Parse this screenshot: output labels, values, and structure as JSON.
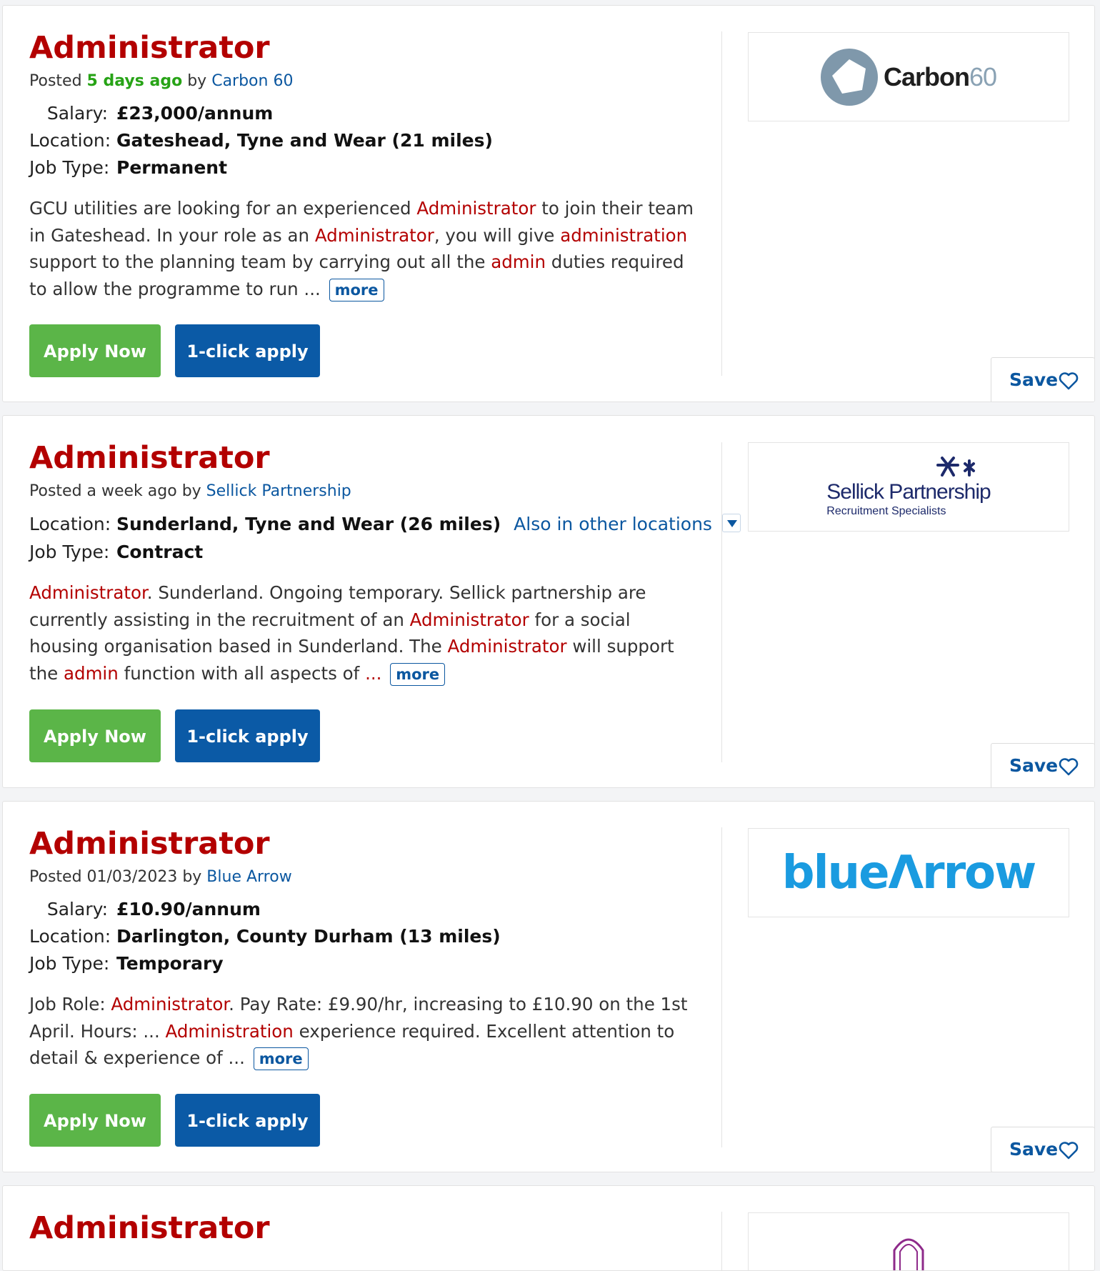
{
  "jobs": [
    {
      "title": "Administrator",
      "posted_prefix": "Posted ",
      "posted_when": "5 days ago",
      "posted_by_text": " by ",
      "company": "Carbon 60",
      "salary_label": "Salary:",
      "salary": "£23,000/annum",
      "location_label": "Location:",
      "location": "Gateshead, Tyne and Wear (21 miles)",
      "jobtype_label": "Job Type:",
      "jobtype": "Permanent",
      "desc": [
        {
          "t": "GCU utilities are looking for an experienced ",
          "h": false
        },
        {
          "t": "Administrator",
          "h": true
        },
        {
          "t": " to join their team in Gateshead. In your role as an ",
          "h": false
        },
        {
          "t": "Administrator",
          "h": true
        },
        {
          "t": ", you will give ",
          "h": false
        },
        {
          "t": "administration",
          "h": true
        },
        {
          "t": " support to the planning team by carrying out all the ",
          "h": false
        },
        {
          "t": "admin",
          "h": true
        },
        {
          "t": " duties required to allow the programme to run ...",
          "h": false
        }
      ],
      "more_label": "more",
      "apply_label": "Apply Now",
      "oneclick_label": "1-click apply",
      "save_label": "Save",
      "logo_text_main": "Carbon",
      "logo_text_num": "60"
    },
    {
      "title": "Administrator",
      "posted_text": "Posted a week ago by ",
      "company": "Sellick Partnership",
      "location_label": "Location:",
      "location": "Sunderland, Tyne and Wear (26 miles)",
      "other_locations": "Also in other locations",
      "jobtype_label": "Job Type:",
      "jobtype": "Contract",
      "desc": [
        {
          "t": "Administrator",
          "h": true
        },
        {
          "t": ". Sunderland. Ongoing temporary. Sellick partnership are currently assisting in the recruitment of an ",
          "h": false
        },
        {
          "t": "Administrator",
          "h": true
        },
        {
          "t": " for a social housing organisation based in Sunderland. The ",
          "h": false
        },
        {
          "t": "Administrator",
          "h": true
        },
        {
          "t": " will support the ",
          "h": false
        },
        {
          "t": "admin",
          "h": true
        },
        {
          "t": " function with all aspects of ",
          "h": false
        },
        {
          "t": "...",
          "h": true
        }
      ],
      "more_label": "more",
      "apply_label": "Apply Now",
      "oneclick_label": "1-click apply",
      "save_label": "Save",
      "logo_name": "Sellick Partnership",
      "logo_tag": "Recruitment Specialists"
    },
    {
      "title": "Administrator",
      "posted_text": "Posted 01/03/2023 by ",
      "company": "Blue Arrow",
      "salary_label": "Salary:",
      "salary": "£10.90/annum",
      "location_label": "Location:",
      "location": "Darlington, County Durham (13 miles)",
      "jobtype_label": "Job Type:",
      "jobtype": "Temporary",
      "desc": [
        {
          "t": "Job Role: ",
          "h": false
        },
        {
          "t": "Administrator",
          "h": true
        },
        {
          "t": ". Pay Rate: £9.90/hr, increasing to £10.90 on the 1st April. Hours: ... ",
          "h": false
        },
        {
          "t": "Administration",
          "h": true
        },
        {
          "t": " experience required. Excellent attention to detail & experience of ...",
          "h": false
        }
      ],
      "more_label": "more",
      "apply_label": "Apply Now",
      "oneclick_label": "1-click apply",
      "save_label": "Save",
      "logo_text": "blueΛrrow"
    },
    {
      "title": "Administrator"
    }
  ],
  "colors": {
    "title_red": "#b30000",
    "link_blue": "#0b57a0",
    "apply_green": "#5bb548",
    "oneclick_blue": "#0b5aa6",
    "recent_green": "#27a316"
  }
}
